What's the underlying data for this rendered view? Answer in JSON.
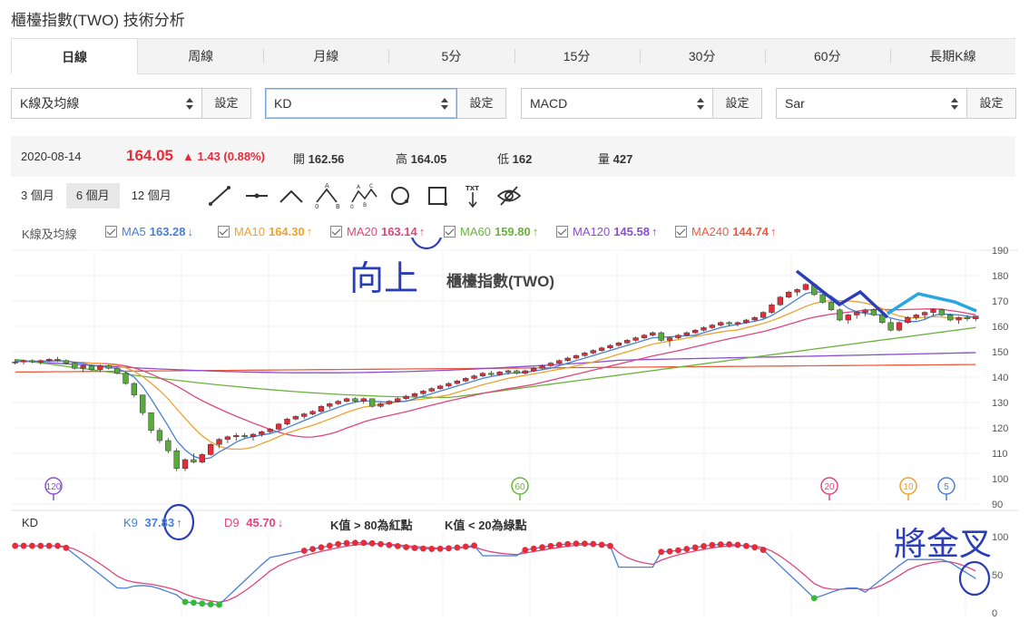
{
  "page": {
    "title": "櫃檯指數(TWO) 技術分析"
  },
  "tabs": [
    {
      "label": "日線",
      "active": true
    },
    {
      "label": "周線"
    },
    {
      "label": "月線"
    },
    {
      "label": "5分"
    },
    {
      "label": "15分"
    },
    {
      "label": "30分"
    },
    {
      "label": "60分"
    },
    {
      "label": "長期K線"
    }
  ],
  "selectors": [
    {
      "value": "K線及均線",
      "button": "設定"
    },
    {
      "value": "KD",
      "button": "設定"
    },
    {
      "value": "MACD",
      "button": "設定"
    },
    {
      "value": "Sar",
      "button": "設定"
    }
  ],
  "quote": {
    "date": "2020-08-14",
    "price": "164.05",
    "change": "1.43 (0.88%)",
    "open_label": "開",
    "open": "162.56",
    "high_label": "高",
    "high": "164.05",
    "low_label": "低",
    "low": "162",
    "volume_label": "量",
    "volume": "427"
  },
  "ranges": [
    {
      "label": "3 個月"
    },
    {
      "label": "6 個月",
      "active": true
    },
    {
      "label": "12 個月"
    }
  ],
  "tools": [
    "line-tool-icon",
    "horizontal-line-tool-icon",
    "angle-tool-icon",
    "abc-pattern-tool-icon",
    "abcd-pattern-tool-icon",
    "circle-tool-icon",
    "rectangle-tool-icon",
    "text-tool-icon",
    "hide-icon"
  ],
  "ma_legend": {
    "label": "K線及均線",
    "items": [
      {
        "name": "MA5",
        "value": "163.28",
        "arrow": "↓",
        "color": "#4a7fd6"
      },
      {
        "name": "MA10",
        "value": "164.30",
        "arrow": "↑",
        "color": "#f0a22e"
      },
      {
        "name": "MA20",
        "value": "163.14",
        "arrow": "↑",
        "color": "#e0457b"
      },
      {
        "name": "MA60",
        "value": "159.80",
        "arrow": "↑",
        "color": "#6cb33e"
      },
      {
        "name": "MA120",
        "value": "145.58",
        "arrow": "↑",
        "color": "#8a4fd0"
      },
      {
        "name": "MA240",
        "value": "144.74",
        "arrow": "↑",
        "color": "#f05a3c"
      }
    ]
  },
  "kd_legend": {
    "label": "KD",
    "k_name": "K9",
    "k_value": "37.83",
    "k_arrow": "↑",
    "k_color": "#4a7fd6",
    "d_name": "D9",
    "d_value": "45.70",
    "d_arrow": "↓",
    "d_color": "#e0457b",
    "note_red": "K值 > 80為紅點",
    "note_green": "K值 < 20為綠點"
  },
  "annotations": {
    "up_text": "向上",
    "cross_text": "將金叉"
  },
  "chart_data": {
    "type": "candlestick",
    "title": "櫃檯指數(TWO)",
    "y_ticks": [
      90,
      100,
      110,
      120,
      130,
      140,
      150,
      160,
      170,
      180,
      190
    ],
    "ylim": [
      90,
      190
    ],
    "kd_ticks": [
      0,
      50,
      100
    ],
    "kd_ylim": [
      0,
      100
    ],
    "ma_markers": [
      "120",
      "60",
      "20",
      "10",
      "5"
    ],
    "colors": {
      "up": "#e52d3a",
      "down": "#5aaa3f",
      "kd_high_dot": "#e52d3a",
      "kd_low_dot": "#33bb33",
      "annotation_blue": "#2b3eb8",
      "annotation_cyan": "#27a7e0"
    },
    "candles_approx": [
      [
        146,
        147,
        145,
        146
      ],
      [
        146,
        147,
        145,
        146.5
      ],
      [
        146.5,
        147,
        145.5,
        146
      ],
      [
        146,
        147,
        145,
        146.5
      ],
      [
        146.5,
        147.5,
        146,
        147
      ],
      [
        147,
        148,
        146,
        146.5
      ],
      [
        146.5,
        147,
        145,
        145.5
      ],
      [
        145.5,
        146,
        143,
        143.5
      ],
      [
        143.5,
        145,
        142,
        144.5
      ],
      [
        144.5,
        145,
        142.5,
        143
      ],
      [
        143,
        145,
        142,
        144.5
      ],
      [
        144.5,
        145,
        143,
        143.5
      ],
      [
        143.5,
        144,
        141,
        141.5
      ],
      [
        141.5,
        142,
        137,
        137.5
      ],
      [
        137.5,
        138,
        132,
        133
      ],
      [
        133,
        133,
        125,
        126
      ],
      [
        126,
        126,
        118,
        119
      ],
      [
        119,
        120,
        114,
        115
      ],
      [
        115,
        116,
        110,
        111
      ],
      [
        111,
        112,
        103,
        104
      ],
      [
        104,
        108,
        103,
        107.5
      ],
      [
        107.5,
        110,
        106,
        106.5
      ],
      [
        106.5,
        110,
        106,
        109.5
      ],
      [
        109.5,
        114,
        109,
        113.5
      ],
      [
        113.5,
        116,
        112,
        115.5
      ],
      [
        115.5,
        117,
        114,
        116.5
      ],
      [
        116.5,
        118,
        115,
        117
      ],
      [
        117,
        118,
        116,
        116.5
      ],
      [
        116.5,
        118,
        115,
        117.5
      ],
      [
        117.5,
        119,
        116.5,
        118.5
      ],
      [
        118.5,
        120,
        118,
        119.5
      ],
      [
        119.5,
        122,
        119,
        121.5
      ],
      [
        121.5,
        124,
        121,
        123.5
      ],
      [
        123.5,
        125,
        123,
        124.5
      ],
      [
        124.5,
        126,
        123.5,
        125.5
      ],
      [
        125.5,
        127,
        125,
        126.5
      ],
      [
        126.5,
        129,
        126,
        128.5
      ],
      [
        128.5,
        130,
        127.5,
        129.5
      ],
      [
        129.5,
        131,
        129,
        130.5
      ],
      [
        130.5,
        132,
        130,
        131.5
      ],
      [
        131.5,
        132,
        130,
        130.5
      ],
      [
        130.5,
        132,
        129.5,
        131.5
      ],
      [
        131.5,
        131.5,
        128,
        128.5
      ],
      [
        128.5,
        130,
        128,
        129.5
      ],
      [
        129.5,
        131,
        129,
        130.5
      ],
      [
        130.5,
        132,
        130,
        131.5
      ],
      [
        131.5,
        133,
        131,
        132.5
      ],
      [
        132.5,
        134,
        132,
        133.5
      ],
      [
        133.5,
        135,
        133,
        134.5
      ],
      [
        134.5,
        136,
        134,
        135.5
      ],
      [
        135.5,
        137,
        135,
        136.5
      ],
      [
        136.5,
        138,
        136,
        137.5
      ],
      [
        137.5,
        139,
        137,
        138.5
      ],
      [
        138.5,
        140,
        138,
        139.5
      ],
      [
        139.5,
        141,
        139,
        140.5
      ],
      [
        140.5,
        142,
        140,
        141.5
      ],
      [
        141.5,
        142.5,
        140.5,
        141
      ],
      [
        141,
        142.5,
        140.5,
        142
      ],
      [
        142,
        143,
        141,
        142.5
      ],
      [
        142.5,
        143,
        141,
        141.5
      ],
      [
        141.5,
        143,
        141,
        142.5
      ],
      [
        142.5,
        144,
        142,
        143.5
      ],
      [
        143.5,
        145,
        143,
        144.5
      ],
      [
        144.5,
        146,
        144,
        145.5
      ],
      [
        145.5,
        147,
        145,
        146.5
      ],
      [
        146.5,
        148,
        146,
        147.5
      ],
      [
        147.5,
        149,
        147,
        148.5
      ],
      [
        148.5,
        150,
        148,
        149.5
      ],
      [
        149.5,
        151,
        149,
        150.5
      ],
      [
        150.5,
        152,
        150,
        151.5
      ],
      [
        151.5,
        153,
        151,
        152.5
      ],
      [
        152.5,
        154,
        152,
        153.5
      ],
      [
        153.5,
        155,
        153,
        154.5
      ],
      [
        154.5,
        156,
        154,
        155.5
      ],
      [
        155.5,
        157,
        155,
        156.5
      ],
      [
        156.5,
        158,
        156,
        157.5
      ],
      [
        157.5,
        158,
        154,
        154.5
      ],
      [
        154.5,
        156,
        152,
        155.5
      ],
      [
        155.5,
        157,
        155,
        156.5
      ],
      [
        156.5,
        158,
        156,
        157.5
      ],
      [
        157.5,
        159,
        157,
        158.5
      ],
      [
        158.5,
        160,
        158,
        159.5
      ],
      [
        159.5,
        161,
        159,
        160.5
      ],
      [
        160.5,
        162,
        160,
        161.5
      ],
      [
        161.5,
        162,
        160,
        161
      ],
      [
        161,
        162,
        160,
        161.5
      ],
      [
        161.5,
        163,
        161,
        162.5
      ],
      [
        162.5,
        164,
        162,
        163.5
      ],
      [
        163.5,
        166,
        163,
        165.5
      ],
      [
        165.5,
        169,
        165,
        168.5
      ],
      [
        168.5,
        172,
        168,
        171.5
      ],
      [
        171.5,
        174,
        171,
        173.5
      ],
      [
        173.5,
        175,
        172,
        174.5
      ],
      [
        174.5,
        177,
        174,
        176.5
      ],
      [
        176.5,
        177,
        172,
        172.5
      ],
      [
        172.5,
        173,
        169,
        169.5
      ],
      [
        169.5,
        170,
        166,
        166.5
      ],
      [
        166.5,
        167,
        162,
        162.5
      ],
      [
        162.5,
        165,
        161,
        164.5
      ],
      [
        164.5,
        166,
        163,
        165.5
      ],
      [
        165.5,
        167,
        164,
        166.5
      ],
      [
        166.5,
        167,
        164,
        164.5
      ],
      [
        164.5,
        165,
        161,
        161.5
      ],
      [
        161.5,
        163,
        158,
        158.5
      ],
      [
        158.5,
        162,
        158,
        161.5
      ],
      [
        161.5,
        164,
        161,
        163.5
      ],
      [
        163.5,
        165,
        162.5,
        164.5
      ],
      [
        164.5,
        166,
        163,
        165.5
      ],
      [
        165.5,
        167,
        164,
        166.5
      ],
      [
        166.5,
        167,
        164,
        164.5
      ],
      [
        164.5,
        165,
        162,
        162.5
      ],
      [
        162.5,
        164,
        161,
        163.5
      ],
      [
        163.5,
        164.5,
        162,
        163
      ],
      [
        163,
        164.05,
        162,
        164.05
      ]
    ]
  }
}
